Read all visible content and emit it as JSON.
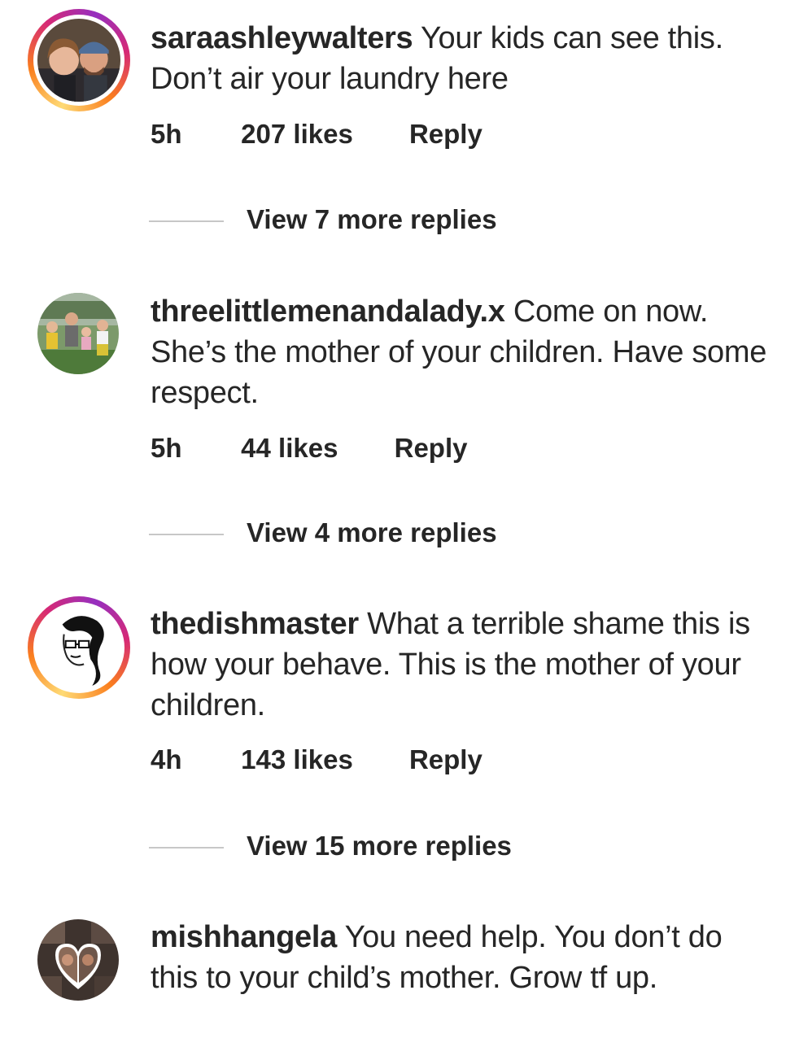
{
  "comments": [
    {
      "username": "saraashleywalters",
      "text": "Your kids can see this. Don’t air your laundry here",
      "time": "5h",
      "likes": "207 likes",
      "reply_label": "Reply",
      "view_replies": "View 7 more replies",
      "avatar_icon": "couple-photo-avatar",
      "has_story_ring": true
    },
    {
      "username": "threelittlemenandalady.x",
      "text": "Come on now. She’s the mother of your children. Have some respect.",
      "time": "5h",
      "likes": "44 likes",
      "reply_label": "Reply",
      "view_replies": "View 4 more replies",
      "avatar_icon": "family-photo-avatar",
      "has_story_ring": false
    },
    {
      "username": "thedishmaster",
      "text": "What a terrible shame this is how your behave. This is the mother of your children.",
      "time": "4h",
      "likes": "143 likes",
      "reply_label": "Reply",
      "view_replies": "View 15 more replies",
      "avatar_icon": "cartoon-face-avatar",
      "has_story_ring": true
    },
    {
      "username": "mishhangela",
      "text": "You need help. You don’t do this to your child’s mother. Grow tf up.",
      "avatar_icon": "collage-photo-avatar",
      "has_story_ring": false
    }
  ],
  "colors": {
    "text": "#262626",
    "divider": "#c7c7c7",
    "story_ring": [
      "#feda75",
      "#fa7e1e",
      "#d62976",
      "#962fbf"
    ]
  }
}
